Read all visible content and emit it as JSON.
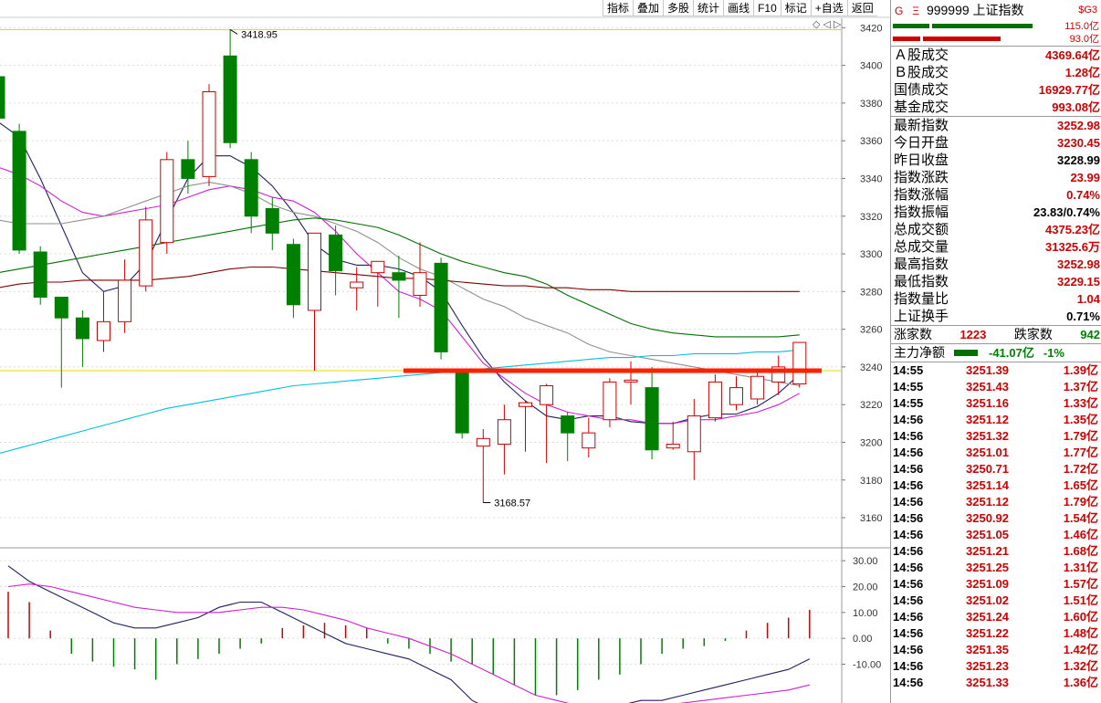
{
  "toolbar": {
    "buttons": [
      "指标",
      "叠加",
      "多股",
      "统计",
      "画线",
      "F10",
      "标记",
      "+自选",
      "返回"
    ]
  },
  "chart_data": [
    {
      "type": "candlestick",
      "ylim": [
        3145,
        3425
      ],
      "yticks": [
        3420,
        3400,
        3380,
        3360,
        3340,
        3320,
        3300,
        3280,
        3260,
        3240,
        3220,
        3200,
        3180,
        3160
      ],
      "high_label": "3418.95",
      "low_label": "3168.57",
      "candles": [
        {
          "o": 3394,
          "h": 3394,
          "l": 3362,
          "c": 3372
        },
        {
          "o": 3365,
          "h": 3369,
          "l": 3300,
          "c": 3302
        },
        {
          "o": 3301,
          "h": 3304,
          "l": 3273,
          "c": 3277
        },
        {
          "o": 3277,
          "h": 3277,
          "l": 3229,
          "c": 3266
        },
        {
          "o": 3266,
          "h": 3270,
          "l": 3240,
          "c": 3255
        },
        {
          "o": 3254,
          "h": 3280,
          "l": 3248,
          "c": 3264
        },
        {
          "o": 3264,
          "h": 3297,
          "l": 3258,
          "c": 3286
        },
        {
          "o": 3283,
          "h": 3325,
          "l": 3280,
          "c": 3318
        },
        {
          "o": 3306,
          "h": 3354,
          "l": 3300,
          "c": 3350
        },
        {
          "o": 3350,
          "h": 3360,
          "l": 3332,
          "c": 3340
        },
        {
          "o": 3341,
          "h": 3390,
          "l": 3336,
          "c": 3386
        },
        {
          "o": 3405,
          "h": 3419,
          "l": 3356,
          "c": 3359
        },
        {
          "o": 3350,
          "h": 3354,
          "l": 3311,
          "c": 3320
        },
        {
          "o": 3324,
          "h": 3330,
          "l": 3302,
          "c": 3311
        },
        {
          "o": 3305,
          "h": 3308,
          "l": 3266,
          "c": 3273
        },
        {
          "o": 3270,
          "h": 3310,
          "l": 3238,
          "c": 3311
        },
        {
          "o": 3310,
          "h": 3315,
          "l": 3278,
          "c": 3291
        },
        {
          "o": 3282,
          "h": 3293,
          "l": 3270,
          "c": 3285
        },
        {
          "o": 3290,
          "h": 3295,
          "l": 3272,
          "c": 3296
        },
        {
          "o": 3290,
          "h": 3299,
          "l": 3266,
          "c": 3286
        },
        {
          "o": 3278,
          "h": 3306,
          "l": 3272,
          "c": 3290
        },
        {
          "o": 3295,
          "h": 3298,
          "l": 3244,
          "c": 3248
        },
        {
          "o": 3237,
          "h": 3237,
          "l": 3202,
          "c": 3205
        },
        {
          "o": 3198,
          "h": 3207,
          "l": 3168,
          "c": 3202
        },
        {
          "o": 3199,
          "h": 3220,
          "l": 3183,
          "c": 3212
        },
        {
          "o": 3219,
          "h": 3222,
          "l": 3195,
          "c": 3221
        },
        {
          "o": 3220,
          "h": 3231,
          "l": 3189,
          "c": 3230
        },
        {
          "o": 3214,
          "h": 3216,
          "l": 3190,
          "c": 3205
        },
        {
          "o": 3197,
          "h": 3213,
          "l": 3192,
          "c": 3205
        },
        {
          "o": 3212,
          "h": 3234,
          "l": 3208,
          "c": 3232
        },
        {
          "o": 3232,
          "h": 3243,
          "l": 3220,
          "c": 3233
        },
        {
          "o": 3229,
          "h": 3240,
          "l": 3191,
          "c": 3196
        },
        {
          "o": 3197,
          "h": 3211,
          "l": 3196,
          "c": 3199
        },
        {
          "o": 3195,
          "h": 3223,
          "l": 3180,
          "c": 3214
        },
        {
          "o": 3213,
          "h": 3236,
          "l": 3211,
          "c": 3232
        },
        {
          "o": 3220,
          "h": 3235,
          "l": 3217,
          "c": 3229
        },
        {
          "o": 3223,
          "h": 3239,
          "l": 3220,
          "c": 3235
        },
        {
          "o": 3232,
          "h": 3246,
          "l": 3225,
          "c": 3240
        },
        {
          "o": 3231,
          "h": 3253,
          "l": 3229,
          "c": 3253
        }
      ],
      "ma_lines": [
        {
          "color": "#202060",
          "values": [
            3370,
            3362,
            3340,
            3315,
            3290,
            3280,
            3283,
            3295,
            3318,
            3340,
            3352,
            3352,
            3346,
            3336,
            3322,
            3305,
            3297,
            3294,
            3294,
            3292,
            3288,
            3280,
            3262,
            3245,
            3232,
            3222,
            3214,
            3212,
            3214,
            3214,
            3211,
            3210,
            3210,
            3213,
            3215,
            3215,
            3219,
            3226,
            3236
          ]
        },
        {
          "color": "#d020d0",
          "values": [
            3346,
            3342,
            3336,
            3328,
            3322,
            3320,
            3322,
            3324,
            3326,
            3330,
            3334,
            3336,
            3334,
            3330,
            3328,
            3322,
            3312,
            3300,
            3290,
            3280,
            3276,
            3270,
            3256,
            3242,
            3234,
            3226,
            3220,
            3216,
            3214,
            3212,
            3212,
            3210,
            3210,
            3212,
            3212,
            3214,
            3216,
            3220,
            3226
          ]
        },
        {
          "color": "#909090",
          "values": [
            3318,
            3316,
            3316,
            3316,
            3318,
            3320,
            3324,
            3328,
            3332,
            3336,
            3338,
            3336,
            3332,
            3326,
            3322,
            3320,
            3316,
            3312,
            3306,
            3298,
            3292,
            3288,
            3282,
            3276,
            3272,
            3266,
            3262,
            3258,
            3252,
            3248,
            3246,
            3244,
            3242,
            3240,
            3238,
            3236,
            3234,
            3232,
            3230
          ]
        },
        {
          "color": "#007000",
          "values": [
            3290,
            3292,
            3294,
            3296,
            3298,
            3300,
            3302,
            3304,
            3306,
            3308,
            3310,
            3312,
            3314,
            3316,
            3318,
            3319,
            3318,
            3316,
            3314,
            3310,
            3305,
            3300,
            3296,
            3293,
            3290,
            3288,
            3284,
            3278,
            3273,
            3268,
            3263,
            3260,
            3258,
            3257,
            3256,
            3256,
            3256,
            3256,
            3257
          ]
        },
        {
          "color": "#800000",
          "values": [
            3282,
            3284,
            3285,
            3285,
            3286,
            3286,
            3286,
            3286,
            3287,
            3288,
            3290,
            3292,
            3293,
            3293,
            3292,
            3291,
            3290,
            3289,
            3288,
            3287,
            3287,
            3286,
            3285,
            3284,
            3283,
            3283,
            3282,
            3282,
            3281,
            3281,
            3280,
            3280,
            3280,
            3280,
            3280,
            3280,
            3280,
            3280,
            3280
          ]
        },
        {
          "color": "#00c0e0",
          "values": [
            3194,
            3197,
            3200,
            3203,
            3206,
            3209,
            3212,
            3215,
            3218,
            3220,
            3222,
            3224,
            3226,
            3228,
            3230,
            3231,
            3232,
            3233,
            3234,
            3235,
            3236,
            3237,
            3238,
            3239,
            3240,
            3241,
            3242,
            3243,
            3244,
            3245,
            3245,
            3246,
            3246,
            3247,
            3247,
            3247,
            3248,
            3248,
            3249
          ]
        }
      ],
      "ref_line": 3238
    },
    {
      "type": "macd",
      "ylim": [
        -25,
        35
      ],
      "yticks": [
        "30.00",
        "20.00",
        "10.00",
        "0.00",
        "-10.00"
      ],
      "histogram": [
        18,
        14,
        3,
        -6,
        -9,
        -11,
        -12,
        -16,
        -10,
        -8,
        -6,
        -4,
        -2,
        4,
        5,
        6,
        5,
        4,
        -2,
        -4,
        -6,
        -9,
        -10,
        -14,
        -18,
        -22,
        -22,
        -20,
        -16,
        -14,
        -10,
        -6,
        -4,
        -3,
        -1,
        3,
        6,
        8,
        11
      ],
      "dif": [
        28,
        22,
        18,
        14,
        10,
        6,
        4,
        4,
        6,
        8,
        12,
        14,
        14,
        10,
        6,
        2,
        -2,
        -4,
        -6,
        -8,
        -12,
        -16,
        -24,
        -28,
        -30,
        -32,
        -32,
        -30,
        -28,
        -26,
        -24,
        -24,
        -22,
        -20,
        -18,
        -16,
        -14,
        -12,
        -8
      ],
      "dea": [
        20,
        21,
        20,
        18,
        16,
        14,
        12,
        11,
        10,
        10,
        10,
        11,
        12,
        12,
        11,
        9,
        7,
        4,
        2,
        0,
        -3,
        -6,
        -10,
        -14,
        -18,
        -22,
        -24,
        -26,
        -27,
        -27,
        -27,
        -26,
        -25,
        -24,
        -23,
        -22,
        -21,
        -20,
        -18
      ]
    }
  ],
  "ctrl_icons": "◇ ◁ ▷",
  "panel": {
    "header": {
      "g": "G",
      "e": "Ξ",
      "code": "999999",
      "name": "上证指数",
      "sg": "$G3"
    },
    "vol_bars": [
      {
        "value": "115.0亿",
        "segments": [
          {
            "color": "#007000",
            "w": 40
          },
          {
            "color": "#007000",
            "w": 110
          }
        ]
      },
      {
        "value": "93.0亿",
        "segments": [
          {
            "color": "#d00000",
            "w": 30
          },
          {
            "color": "#d00000",
            "w": 85
          }
        ]
      }
    ],
    "turnover": [
      {
        "label": "Ａ股成交",
        "value": "4369.64亿",
        "cls": "red"
      },
      {
        "label": "Ｂ股成交",
        "value": "1.28亿",
        "cls": "red"
      },
      {
        "label": "国债成交",
        "value": "16929.77亿",
        "cls": "red"
      },
      {
        "label": "基金成交",
        "value": "993.08亿",
        "cls": "red"
      }
    ],
    "stats": [
      {
        "label": "最新指数",
        "value": "3252.98",
        "cls": "red"
      },
      {
        "label": "今日开盘",
        "value": "3230.45",
        "cls": "red"
      },
      {
        "label": "昨日收盘",
        "value": "3228.99",
        "cls": "blk"
      },
      {
        "label": "指数涨跌",
        "value": "23.99",
        "cls": "red"
      },
      {
        "label": "指数涨幅",
        "value": "0.74%",
        "cls": "red"
      },
      {
        "label": "指数振幅",
        "value": "23.83/0.74%",
        "cls": "blk"
      },
      {
        "label": "总成交额",
        "value": "4375.23亿",
        "cls": "red"
      },
      {
        "label": "总成交量",
        "value": "31325.6万",
        "cls": "red"
      },
      {
        "label": "最高指数",
        "value": "3252.98",
        "cls": "red"
      },
      {
        "label": "最低指数",
        "value": "3229.15",
        "cls": "red"
      },
      {
        "label": "指数量比",
        "value": "1.04",
        "cls": "red"
      },
      {
        "label": "上证换手",
        "value": "0.71%",
        "cls": "blk"
      }
    ],
    "updown": {
      "up_label": "涨家数",
      "up": "1223",
      "down_label": "跌家数",
      "down": "942"
    },
    "main_net": {
      "label": "主力净额",
      "value": "-41.07亿",
      "pct": "-1%"
    },
    "ticks": [
      {
        "t": "14:55",
        "p": "3251.39",
        "a": "1.39亿"
      },
      {
        "t": "14:55",
        "p": "3251.43",
        "a": "1.37亿"
      },
      {
        "t": "14:55",
        "p": "3251.16",
        "a": "1.33亿"
      },
      {
        "t": "14:56",
        "p": "3251.12",
        "a": "1.35亿"
      },
      {
        "t": "14:56",
        "p": "3251.32",
        "a": "1.79亿"
      },
      {
        "t": "14:56",
        "p": "3251.01",
        "a": "1.77亿"
      },
      {
        "t": "14:56",
        "p": "3250.71",
        "a": "1.72亿"
      },
      {
        "t": "14:56",
        "p": "3251.14",
        "a": "1.65亿"
      },
      {
        "t": "14:56",
        "p": "3251.12",
        "a": "1.79亿"
      },
      {
        "t": "14:56",
        "p": "3250.92",
        "a": "1.54亿"
      },
      {
        "t": "14:56",
        "p": "3251.05",
        "a": "1.46亿"
      },
      {
        "t": "14:56",
        "p": "3251.21",
        "a": "1.68亿"
      },
      {
        "t": "14:56",
        "p": "3251.25",
        "a": "1.31亿"
      },
      {
        "t": "14:56",
        "p": "3251.09",
        "a": "1.57亿"
      },
      {
        "t": "14:56",
        "p": "3251.02",
        "a": "1.51亿"
      },
      {
        "t": "14:56",
        "p": "3251.24",
        "a": "1.60亿"
      },
      {
        "t": "14:56",
        "p": "3251.22",
        "a": "1.48亿"
      },
      {
        "t": "14:56",
        "p": "3251.35",
        "a": "1.42亿"
      },
      {
        "t": "14:56",
        "p": "3251.23",
        "a": "1.32亿"
      },
      {
        "t": "14:56",
        "p": "3251.33",
        "a": "1.36亿"
      }
    ]
  },
  "colors": {
    "up": "#d00000",
    "down": "#008000",
    "grid": "#dcdcdc",
    "support": "#ff2000"
  }
}
